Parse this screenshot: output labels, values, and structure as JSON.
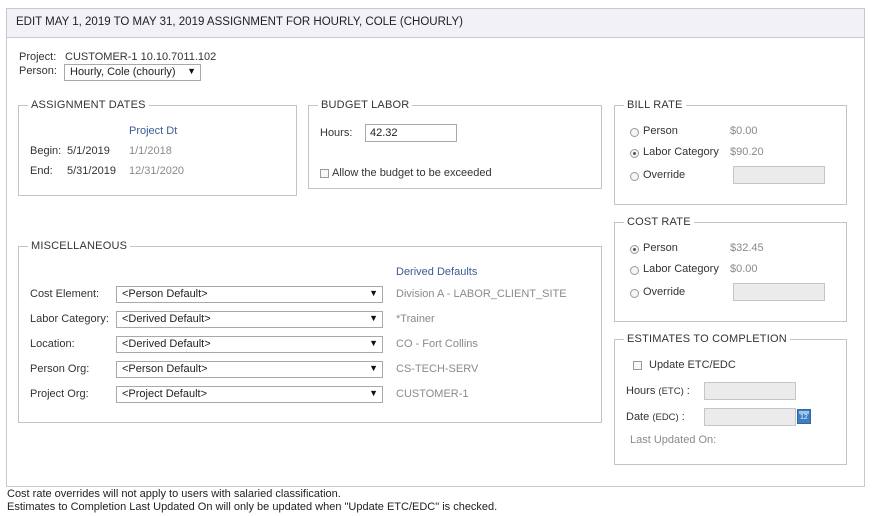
{
  "title": "EDIT MAY 1, 2019 TO MAY 31, 2019 ASSIGNMENT FOR HOURLY, COLE (CHOURLY)",
  "project": {
    "label": "Project:",
    "value": "CUSTOMER-1 10.10.7011.102"
  },
  "person": {
    "label": "Person:",
    "value": "Hourly, Cole (chourly)"
  },
  "assignment_dates": {
    "legend": "ASSIGNMENT DATES",
    "project_dt_header": "Project Dt",
    "begin_label": "Begin:",
    "begin": "5/1/2019",
    "begin_project": "1/1/2018",
    "end_label": "End:",
    "end": "5/31/2019",
    "end_project": "12/31/2020"
  },
  "budget_labor": {
    "legend": "BUDGET LABOR",
    "hours_label": "Hours:",
    "hours": "42.32",
    "allow_exceed_label": "Allow the budget to be exceeded",
    "allow_exceed_checked": false
  },
  "bill_rate": {
    "legend": "BILL RATE",
    "options": [
      {
        "label": "Person",
        "value": "$0.00",
        "selected": false
      },
      {
        "label": "Labor Category",
        "value": "$90.20",
        "selected": true
      },
      {
        "label": "Override",
        "value": "",
        "selected": false
      }
    ]
  },
  "cost_rate": {
    "legend": "COST RATE",
    "options": [
      {
        "label": "Person",
        "value": "$32.45",
        "selected": true
      },
      {
        "label": "Labor Category",
        "value": "$0.00",
        "selected": false
      },
      {
        "label": "Override",
        "value": "",
        "selected": false
      }
    ]
  },
  "misc": {
    "legend": "MISCELLANEOUS",
    "derived_header": "Derived Defaults",
    "rows": [
      {
        "label": "Cost Element:",
        "select": "<Person Default>",
        "derived": "Division A - LABOR_CLIENT_SITE"
      },
      {
        "label": "Labor Category:",
        "select": "<Derived Default>",
        "derived": "*Trainer"
      },
      {
        "label": "Location:",
        "select": "<Derived Default>",
        "derived": "CO - Fort Collins"
      },
      {
        "label": "Person Org:",
        "select": "<Person Default>",
        "derived": "CS-TECH-SERV"
      },
      {
        "label": "Project Org:",
        "select": "<Project Default>",
        "derived": "CUSTOMER-1"
      }
    ]
  },
  "etc": {
    "legend": "ESTIMATES TO COMPLETION",
    "update_label": "Update ETC/EDC",
    "update_checked": false,
    "hours_label": "Hours",
    "hours_suffix": "(ETC)",
    "hours_colon": ":",
    "date_label": "Date",
    "date_suffix": "(EDC)",
    "date_colon": ":",
    "calendar_day": "12",
    "last_updated_label": "Last Updated On:"
  },
  "notes": [
    "Cost rate overrides will not apply to users with salaried classification.",
    "Estimates to Completion Last Updated On will only be updated when \"Update ETC/EDC\" is checked."
  ]
}
